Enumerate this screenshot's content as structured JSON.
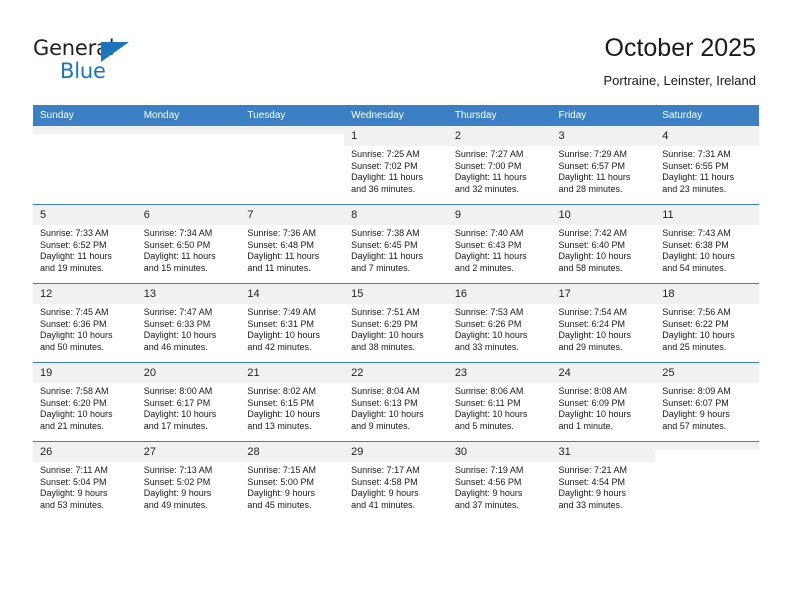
{
  "brand": {
    "name_top": "General",
    "name_bottom": "Blue",
    "accent_color": "#1b75bb"
  },
  "header": {
    "title": "October 2025",
    "subtitle": "Portraine, Leinster, Ireland"
  },
  "theme": {
    "header_row_bg": "#3b7fc4",
    "daynum_bg": "#f1f1f1",
    "grid_line": "#3b7fc4"
  },
  "weekday_headers": [
    "Sunday",
    "Monday",
    "Tuesday",
    "Wednesday",
    "Thursday",
    "Friday",
    "Saturday"
  ],
  "weeks": [
    [
      {
        "day": "",
        "lines": []
      },
      {
        "day": "",
        "lines": []
      },
      {
        "day": "",
        "lines": []
      },
      {
        "day": "1",
        "lines": [
          "Sunrise: 7:25 AM",
          "Sunset: 7:02 PM",
          "Daylight: 11 hours",
          "and 36 minutes."
        ]
      },
      {
        "day": "2",
        "lines": [
          "Sunrise: 7:27 AM",
          "Sunset: 7:00 PM",
          "Daylight: 11 hours",
          "and 32 minutes."
        ]
      },
      {
        "day": "3",
        "lines": [
          "Sunrise: 7:29 AM",
          "Sunset: 6:57 PM",
          "Daylight: 11 hours",
          "and 28 minutes."
        ]
      },
      {
        "day": "4",
        "lines": [
          "Sunrise: 7:31 AM",
          "Sunset: 6:55 PM",
          "Daylight: 11 hours",
          "and 23 minutes."
        ]
      }
    ],
    [
      {
        "day": "5",
        "lines": [
          "Sunrise: 7:33 AM",
          "Sunset: 6:52 PM",
          "Daylight: 11 hours",
          "and 19 minutes."
        ]
      },
      {
        "day": "6",
        "lines": [
          "Sunrise: 7:34 AM",
          "Sunset: 6:50 PM",
          "Daylight: 11 hours",
          "and 15 minutes."
        ]
      },
      {
        "day": "7",
        "lines": [
          "Sunrise: 7:36 AM",
          "Sunset: 6:48 PM",
          "Daylight: 11 hours",
          "and 11 minutes."
        ]
      },
      {
        "day": "8",
        "lines": [
          "Sunrise: 7:38 AM",
          "Sunset: 6:45 PM",
          "Daylight: 11 hours",
          "and 7 minutes."
        ]
      },
      {
        "day": "9",
        "lines": [
          "Sunrise: 7:40 AM",
          "Sunset: 6:43 PM",
          "Daylight: 11 hours",
          "and 2 minutes."
        ]
      },
      {
        "day": "10",
        "lines": [
          "Sunrise: 7:42 AM",
          "Sunset: 6:40 PM",
          "Daylight: 10 hours",
          "and 58 minutes."
        ]
      },
      {
        "day": "11",
        "lines": [
          "Sunrise: 7:43 AM",
          "Sunset: 6:38 PM",
          "Daylight: 10 hours",
          "and 54 minutes."
        ]
      }
    ],
    [
      {
        "day": "12",
        "lines": [
          "Sunrise: 7:45 AM",
          "Sunset: 6:36 PM",
          "Daylight: 10 hours",
          "and 50 minutes."
        ]
      },
      {
        "day": "13",
        "lines": [
          "Sunrise: 7:47 AM",
          "Sunset: 6:33 PM",
          "Daylight: 10 hours",
          "and 46 minutes."
        ]
      },
      {
        "day": "14",
        "lines": [
          "Sunrise: 7:49 AM",
          "Sunset: 6:31 PM",
          "Daylight: 10 hours",
          "and 42 minutes."
        ]
      },
      {
        "day": "15",
        "lines": [
          "Sunrise: 7:51 AM",
          "Sunset: 6:29 PM",
          "Daylight: 10 hours",
          "and 38 minutes."
        ]
      },
      {
        "day": "16",
        "lines": [
          "Sunrise: 7:53 AM",
          "Sunset: 6:26 PM",
          "Daylight: 10 hours",
          "and 33 minutes."
        ]
      },
      {
        "day": "17",
        "lines": [
          "Sunrise: 7:54 AM",
          "Sunset: 6:24 PM",
          "Daylight: 10 hours",
          "and 29 minutes."
        ]
      },
      {
        "day": "18",
        "lines": [
          "Sunrise: 7:56 AM",
          "Sunset: 6:22 PM",
          "Daylight: 10 hours",
          "and 25 minutes."
        ]
      }
    ],
    [
      {
        "day": "19",
        "lines": [
          "Sunrise: 7:58 AM",
          "Sunset: 6:20 PM",
          "Daylight: 10 hours",
          "and 21 minutes."
        ]
      },
      {
        "day": "20",
        "lines": [
          "Sunrise: 8:00 AM",
          "Sunset: 6:17 PM",
          "Daylight: 10 hours",
          "and 17 minutes."
        ]
      },
      {
        "day": "21",
        "lines": [
          "Sunrise: 8:02 AM",
          "Sunset: 6:15 PM",
          "Daylight: 10 hours",
          "and 13 minutes."
        ]
      },
      {
        "day": "22",
        "lines": [
          "Sunrise: 8:04 AM",
          "Sunset: 6:13 PM",
          "Daylight: 10 hours",
          "and 9 minutes."
        ]
      },
      {
        "day": "23",
        "lines": [
          "Sunrise: 8:06 AM",
          "Sunset: 6:11 PM",
          "Daylight: 10 hours",
          "and 5 minutes."
        ]
      },
      {
        "day": "24",
        "lines": [
          "Sunrise: 8:08 AM",
          "Sunset: 6:09 PM",
          "Daylight: 10 hours",
          "and 1 minute."
        ]
      },
      {
        "day": "25",
        "lines": [
          "Sunrise: 8:09 AM",
          "Sunset: 6:07 PM",
          "Daylight: 9 hours",
          "and 57 minutes."
        ]
      }
    ],
    [
      {
        "day": "26",
        "lines": [
          "Sunrise: 7:11 AM",
          "Sunset: 5:04 PM",
          "Daylight: 9 hours",
          "and 53 minutes."
        ]
      },
      {
        "day": "27",
        "lines": [
          "Sunrise: 7:13 AM",
          "Sunset: 5:02 PM",
          "Daylight: 9 hours",
          "and 49 minutes."
        ]
      },
      {
        "day": "28",
        "lines": [
          "Sunrise: 7:15 AM",
          "Sunset: 5:00 PM",
          "Daylight: 9 hours",
          "and 45 minutes."
        ]
      },
      {
        "day": "29",
        "lines": [
          "Sunrise: 7:17 AM",
          "Sunset: 4:58 PM",
          "Daylight: 9 hours",
          "and 41 minutes."
        ]
      },
      {
        "day": "30",
        "lines": [
          "Sunrise: 7:19 AM",
          "Sunset: 4:56 PM",
          "Daylight: 9 hours",
          "and 37 minutes."
        ]
      },
      {
        "day": "31",
        "lines": [
          "Sunrise: 7:21 AM",
          "Sunset: 4:54 PM",
          "Daylight: 9 hours",
          "and 33 minutes."
        ]
      },
      {
        "day": "",
        "lines": []
      }
    ]
  ]
}
